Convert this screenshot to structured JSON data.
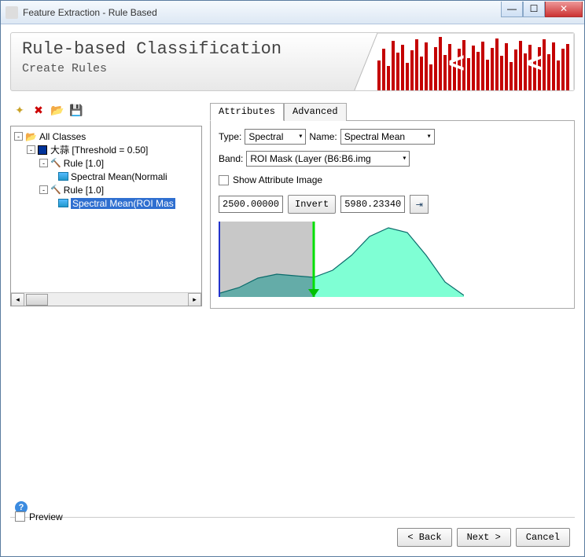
{
  "window": {
    "title": "Feature Extraction - Rule Based"
  },
  "header": {
    "title": "Rule-based Classification",
    "subtitle": "Create Rules"
  },
  "tree": {
    "root": "All Classes",
    "class1": "大蒜 [Threshold = 0.50]",
    "rule1": "Rule [1.0]",
    "leaf1": "Spectral Mean(Normali",
    "rule2": "Rule [1.0]",
    "leaf2": "Spectral Mean(ROI Mas"
  },
  "tabs": {
    "attributes": "Attributes",
    "advanced": "Advanced"
  },
  "form": {
    "type_label": "Type:",
    "type_value": "Spectral",
    "name_label": "Name:",
    "name_value": "Spectral Mean",
    "band_label": "Band:",
    "band_value": "ROI Mask (Layer (B6:B6.img",
    "show_attr_label": "Show Attribute Image",
    "val_min": "2500.00000",
    "invert_label": "Invert",
    "val_max": "5980.23340"
  },
  "chart_data": {
    "type": "area",
    "title": "",
    "xlabel": "",
    "ylabel": "",
    "xlim": [
      0,
      6500
    ],
    "ylim": [
      0,
      1
    ],
    "threshold": 2500,
    "series": [
      {
        "name": "density",
        "x": [
          0,
          500,
          1000,
          1500,
          2000,
          2500,
          3000,
          3500,
          4000,
          4500,
          5000,
          5500,
          6000,
          6500
        ],
        "values": [
          0.05,
          0.12,
          0.25,
          0.3,
          0.28,
          0.26,
          0.35,
          0.55,
          0.8,
          0.92,
          0.85,
          0.55,
          0.2,
          0.02
        ]
      }
    ]
  },
  "footer": {
    "preview": "Preview",
    "back": "< Back",
    "next": "Next >",
    "cancel": "Cancel"
  }
}
